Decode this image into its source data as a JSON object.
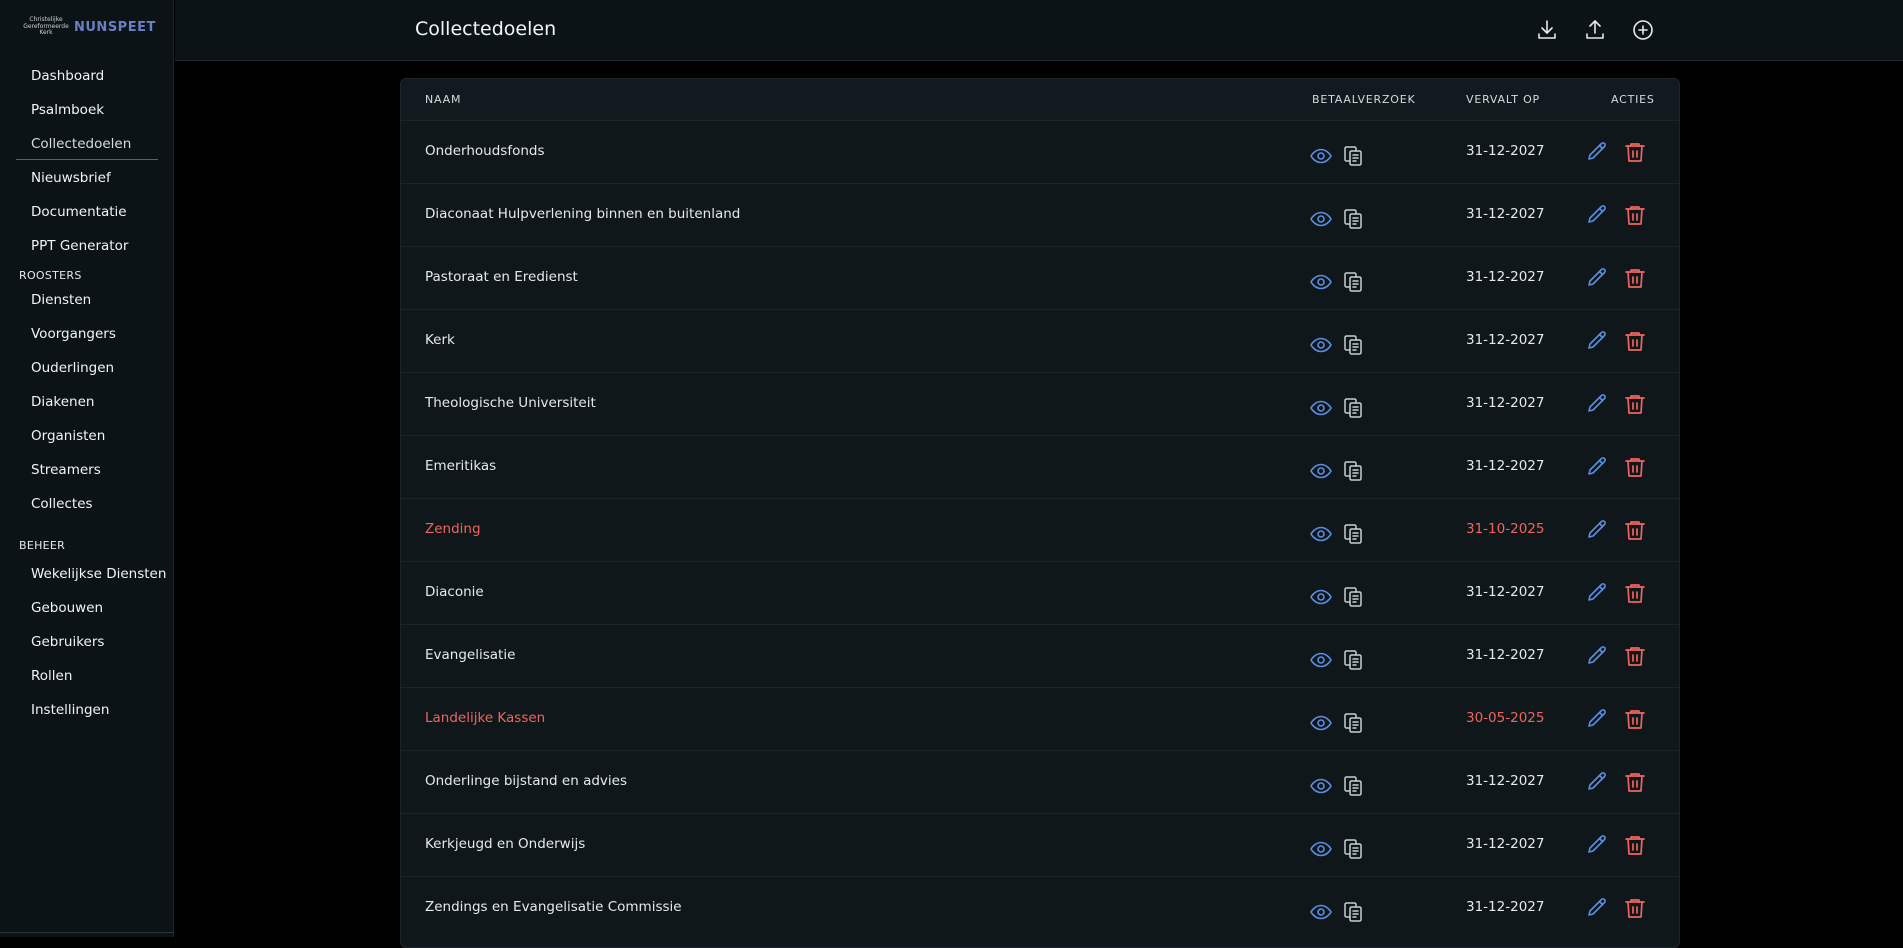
{
  "logo": {
    "small_line1": "Christelijke",
    "small_line2": "Gereformeerde",
    "small_line3": "Kerk",
    "main": "NUNSPEET"
  },
  "sidebar": {
    "items": [
      {
        "label": "Dashboard"
      },
      {
        "label": "Psalmboek"
      },
      {
        "label": "Collectedoelen"
      },
      {
        "label": "Nieuwsbrief"
      },
      {
        "label": "Documentatie"
      },
      {
        "label": "PPT Generator"
      }
    ],
    "roosters_label": "ROOSTERS",
    "roosters": [
      {
        "label": "Diensten"
      },
      {
        "label": "Voorgangers"
      },
      {
        "label": "Ouderlingen"
      },
      {
        "label": "Diakenen"
      },
      {
        "label": "Organisten"
      },
      {
        "label": "Streamers"
      },
      {
        "label": "Collectes"
      }
    ],
    "beheer_label": "BEHEER",
    "beheer": [
      {
        "label": "Wekelijkse Diensten"
      },
      {
        "label": "Gebouwen"
      },
      {
        "label": "Gebruikers"
      },
      {
        "label": "Rollen"
      },
      {
        "label": "Instellingen"
      }
    ]
  },
  "header": {
    "title": "Collectedoelen",
    "icons": [
      "download-icon",
      "upload-icon",
      "add-circle-icon"
    ]
  },
  "table": {
    "columns": {
      "name": "NAAM",
      "payment": "BETAALVERZOEK",
      "expires": "VERVALT OP",
      "actions": "ACTIES"
    },
    "rows": [
      {
        "name": "Onderhoudsfonds",
        "expires": "31-12-2027",
        "expired": false
      },
      {
        "name": "Diaconaat Hulpverlening binnen en buitenland",
        "expires": "31-12-2027",
        "expired": false
      },
      {
        "name": "Pastoraat en Eredienst",
        "expires": "31-12-2027",
        "expired": false
      },
      {
        "name": "Kerk",
        "expires": "31-12-2027",
        "expired": false
      },
      {
        "name": "Theologische Universiteit",
        "expires": "31-12-2027",
        "expired": false
      },
      {
        "name": "Emeritikas",
        "expires": "31-12-2027",
        "expired": false
      },
      {
        "name": "Zending",
        "expires": "31-10-2025",
        "expired": true
      },
      {
        "name": "Diaconie",
        "expires": "31-12-2027",
        "expired": false
      },
      {
        "name": "Evangelisatie",
        "expires": "31-12-2027",
        "expired": false
      },
      {
        "name": "Landelijke Kassen",
        "expires": "30-05-2025",
        "expired": true
      },
      {
        "name": "Onderlinge bijstand en advies",
        "expires": "31-12-2027",
        "expired": false
      },
      {
        "name": "Kerkjeugd en Onderwijs",
        "expires": "31-12-2027",
        "expired": false
      },
      {
        "name": "Zendings en Evangelisatie Commissie",
        "expires": "31-12-2027",
        "expired": false
      }
    ]
  },
  "colors": {
    "accent_blue": "#5b8ee0",
    "danger_red": "#f0645f",
    "icon_grey": "#c9cfd4"
  }
}
